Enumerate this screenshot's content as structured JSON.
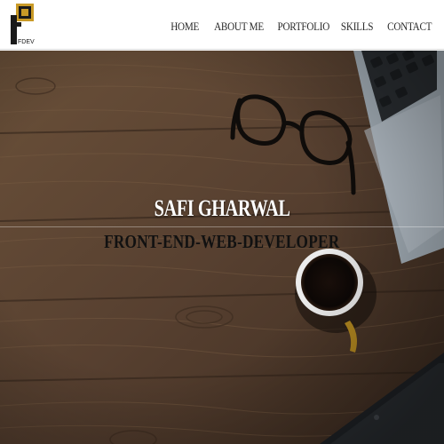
{
  "brand": {
    "logo_text": "FDEV",
    "colors": {
      "logo_dark": "#1a1a1a",
      "logo_gold": "#c99a27"
    }
  },
  "nav": {
    "items": [
      {
        "label": "Home"
      },
      {
        "label": "About Me"
      },
      {
        "label": "Portfolio"
      },
      {
        "label": "Skills"
      },
      {
        "label": "Contact"
      }
    ]
  },
  "hero": {
    "name": "Safi Gharwal",
    "title": "Front-End-Web-Developer",
    "colors": {
      "wood": "#5b4330",
      "name_text": "#ffffff",
      "title_text": "#111111"
    }
  }
}
